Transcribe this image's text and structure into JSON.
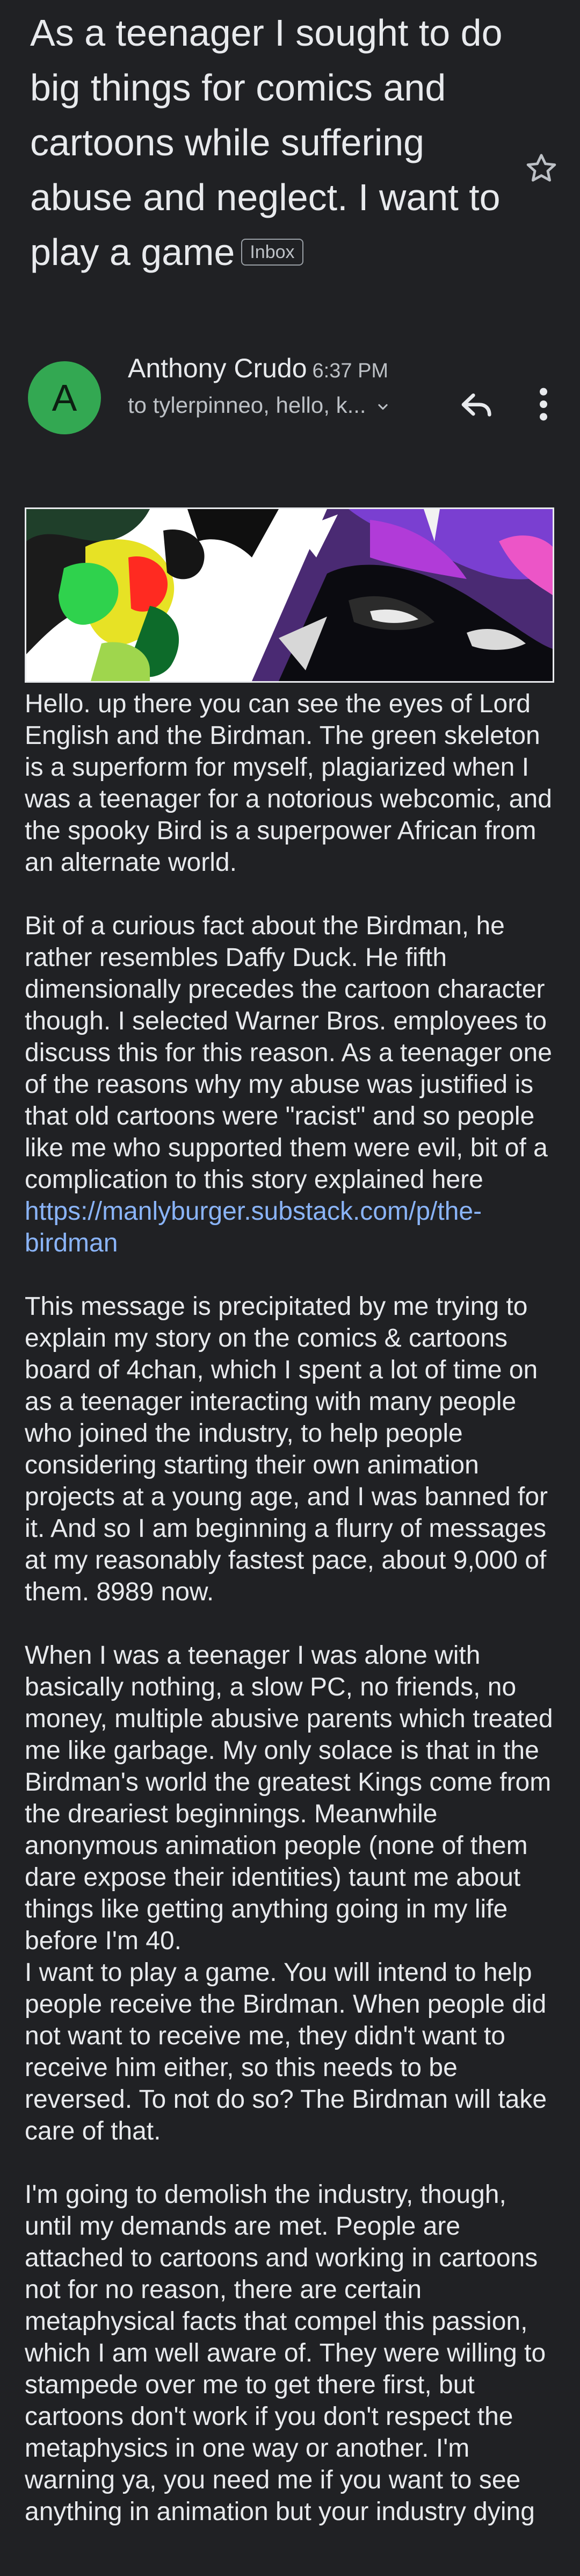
{
  "email": {
    "subject": "As a teenager I sought to do big things for comics and cartoons while suffering abuse and neglect. I want to play a game",
    "label_chip": "Inbox",
    "sender": {
      "initial": "A",
      "name": "Anthony Crudo",
      "time": "6:37 PM",
      "recipients": "to tylerpinneo, hello, k..."
    },
    "body": {
      "p1": "Hello. up there you can see the eyes of Lord English and the Birdman. The green skeleton is a superform for myself, plagiarized when I was a teenager for a notorious webcomic, and the spooky Bird is a superpower African from an alternate world.",
      "p2_text": "Bit of a curious fact about the Birdman, he rather resembles Daffy Duck. He fifth dimensionally precedes the cartoon character though. I selected Warner Bros. employees to discuss this for this reason. As a teenager one of the reasons why my abuse was justified is that old cartoons were \"racist\" and so people like me who supported them were evil, bit of a complication to this story explained here",
      "p2_link": "https://manlyburger.substack.com/p/the-birdman",
      "p3": "This message is precipitated by me trying to explain my story on the comics & cartoons board of 4chan, which I spent a lot of time on as a teenager interacting with many people who joined the industry, to help people considering starting their own animation projects at a young age, and I was banned for it. And so I am beginning a flurry of messages at my reasonably fastest pace, about 9,000 of them. 8989 now.",
      "p4": "When I was a teenager I was alone with basically nothing, a slow PC, no friends, no money, multiple abusive parents which treated me like garbage. My only solace is that in the Birdman's world the greatest Kings come from the dreariest beginnings. Meanwhile anonymous animation people (none of them dare expose their identities) taunt me about things like getting anything going in my life before I'm 40.",
      "p5": "I want to play a game. You will intend to help people receive the Birdman. When people did not want to receive me, they didn't want to receive him either, so this needs to be reversed. To not do so? The Birdman will take care of that.",
      "p6": "I'm going to demolish the industry, though, until my demands are met. People are attached to cartoons and working in cartoons not for no reason, there are certain metaphysical facts that compel this passion, which I am well aware of. They were willing to stampede over me to get there first, but cartoons don't work if you don't respect the metaphysics in one way or another. I'm warning ya, you need me if you want to see anything in animation but your industry dying"
    }
  },
  "icons": {
    "star": "star-outline-icon",
    "reply": "reply-arrow-icon",
    "more": "three-dot-vertical-icon",
    "expand": "chevron-down-icon"
  },
  "colors": {
    "background": "#202124",
    "text": "#e8eaed",
    "secondary_text": "#bdc1c6",
    "link": "#8ab4f8",
    "avatar": "#33a852"
  }
}
